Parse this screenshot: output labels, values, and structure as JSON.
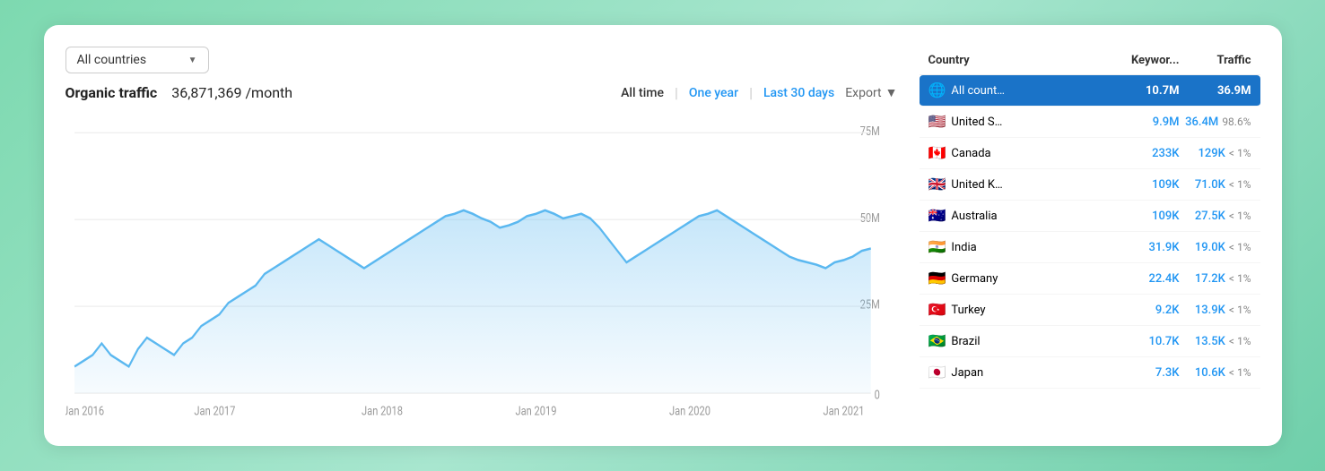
{
  "dropdown": {
    "label": "All countries",
    "arrow": "▼"
  },
  "traffic": {
    "label": "Organic traffic",
    "value": "36,871,369 /month"
  },
  "timeFilters": [
    {
      "label": "All time",
      "type": "active"
    },
    {
      "label": "One year",
      "type": "link"
    },
    {
      "label": "Last 30 days",
      "type": "link"
    }
  ],
  "export": {
    "label": "Export",
    "arrow": "▼"
  },
  "chart": {
    "xLabels": [
      "Jan 2016",
      "Jan 2017",
      "Jan 2018",
      "Jan 2019",
      "Jan 2020",
      "Jan 2021"
    ],
    "yLabels": [
      "75M",
      "50M",
      "25M",
      "0"
    ],
    "accentColor": "#5bb8f0"
  },
  "table": {
    "headers": {
      "country": "Country",
      "keywords": "Keywor...",
      "traffic": "Traffic"
    },
    "rows": [
      {
        "country": "All count…",
        "keywords": "10.7M",
        "traffic": "36.9M",
        "pct": "",
        "highlighted": true,
        "flag": "🌐"
      },
      {
        "country": "United S…",
        "keywords": "9.9M",
        "traffic": "36.4M",
        "pct": "98.6%",
        "highlighted": false,
        "flag": "🇺🇸"
      },
      {
        "country": "Canada",
        "keywords": "233K",
        "traffic": "129K",
        "pct": "< 1%",
        "highlighted": false,
        "flag": "🇨🇦"
      },
      {
        "country": "United K…",
        "keywords": "109K",
        "traffic": "71.0K",
        "pct": "< 1%",
        "highlighted": false,
        "flag": "🇬🇧"
      },
      {
        "country": "Australia",
        "keywords": "109K",
        "traffic": "27.5K",
        "pct": "< 1%",
        "highlighted": false,
        "flag": "🇦🇺"
      },
      {
        "country": "India",
        "keywords": "31.9K",
        "traffic": "19.0K",
        "pct": "< 1%",
        "highlighted": false,
        "flag": "🇮🇳"
      },
      {
        "country": "Germany",
        "keywords": "22.4K",
        "traffic": "17.2K",
        "pct": "< 1%",
        "highlighted": false,
        "flag": "🇩🇪"
      },
      {
        "country": "Turkey",
        "keywords": "9.2K",
        "traffic": "13.9K",
        "pct": "< 1%",
        "highlighted": false,
        "flag": "🇹🇷"
      },
      {
        "country": "Brazil",
        "keywords": "10.7K",
        "traffic": "13.5K",
        "pct": "< 1%",
        "highlighted": false,
        "flag": "🇧🇷"
      },
      {
        "country": "Japan",
        "keywords": "7.3K",
        "traffic": "10.6K",
        "pct": "< 1%",
        "highlighted": false,
        "flag": "🇯🇵"
      }
    ]
  }
}
